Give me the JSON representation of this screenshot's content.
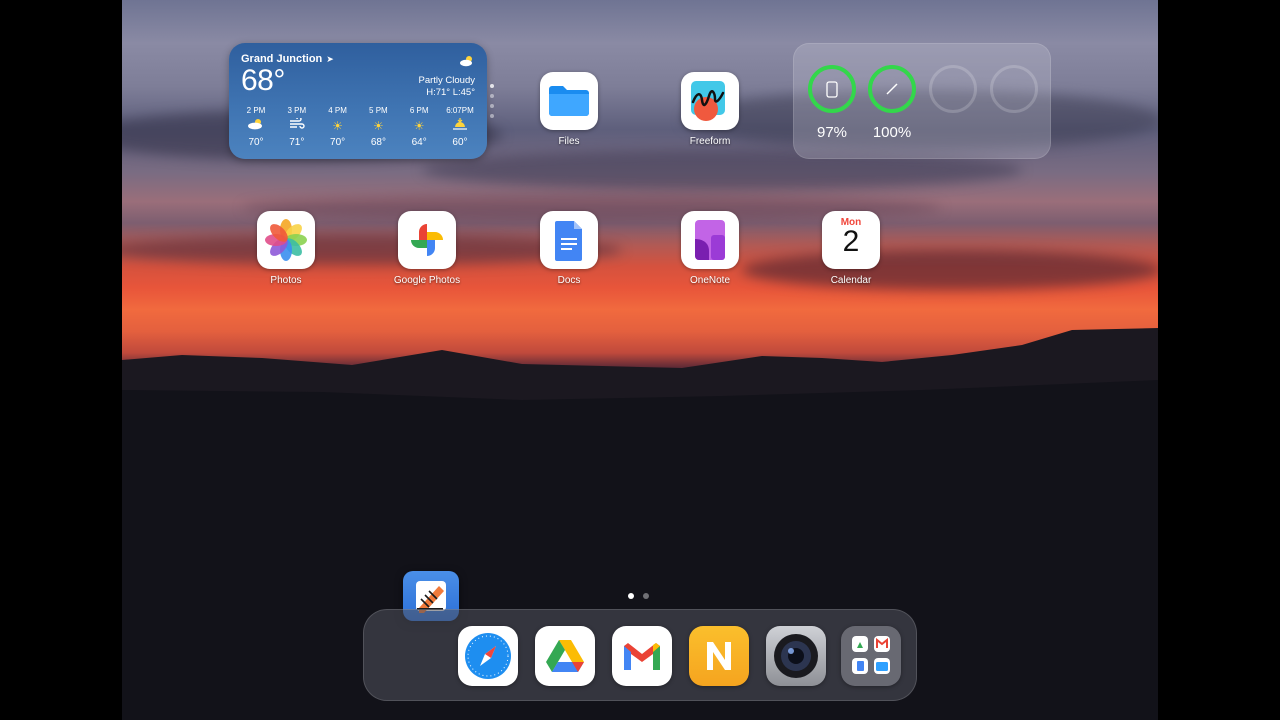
{
  "weather": {
    "city": "Grand Junction",
    "temperature": "68°",
    "condition": "Partly Cloudy",
    "high_low": "H:71° L:45°",
    "hourly": [
      {
        "time": "2 PM",
        "icon": "partly-cloudy-icon",
        "temp": "70°"
      },
      {
        "time": "3 PM",
        "icon": "wind-icon",
        "temp": "71°"
      },
      {
        "time": "4 PM",
        "icon": "sun-icon",
        "temp": "70°"
      },
      {
        "time": "5 PM",
        "icon": "sun-icon",
        "temp": "68°"
      },
      {
        "time": "6 PM",
        "icon": "sun-icon",
        "temp": "64°"
      },
      {
        "time": "6:07PM",
        "icon": "sunset-icon",
        "temp": "60°"
      }
    ]
  },
  "batteries": {
    "ring_color": "#33d74b",
    "items": [
      {
        "device": "ipad-icon",
        "percent": "97%",
        "level": 0.97
      },
      {
        "device": "pencil-icon",
        "percent": "100%",
        "level": 1.0
      }
    ]
  },
  "apps": {
    "files": "Files",
    "freeform": "Freeform",
    "photos": "Photos",
    "google_photos": "Google Photos",
    "docs": "Docs",
    "onenote": "OneNote",
    "calendar": "Calendar",
    "calendar_day": "Mon",
    "calendar_date": "2"
  },
  "dock": {
    "apps": [
      "safari-icon",
      "google-drive-icon",
      "gmail-icon",
      "notability-icon",
      "camera-app-icon",
      "app-library-icon"
    ]
  },
  "pages": {
    "count": 2,
    "active": 1
  }
}
